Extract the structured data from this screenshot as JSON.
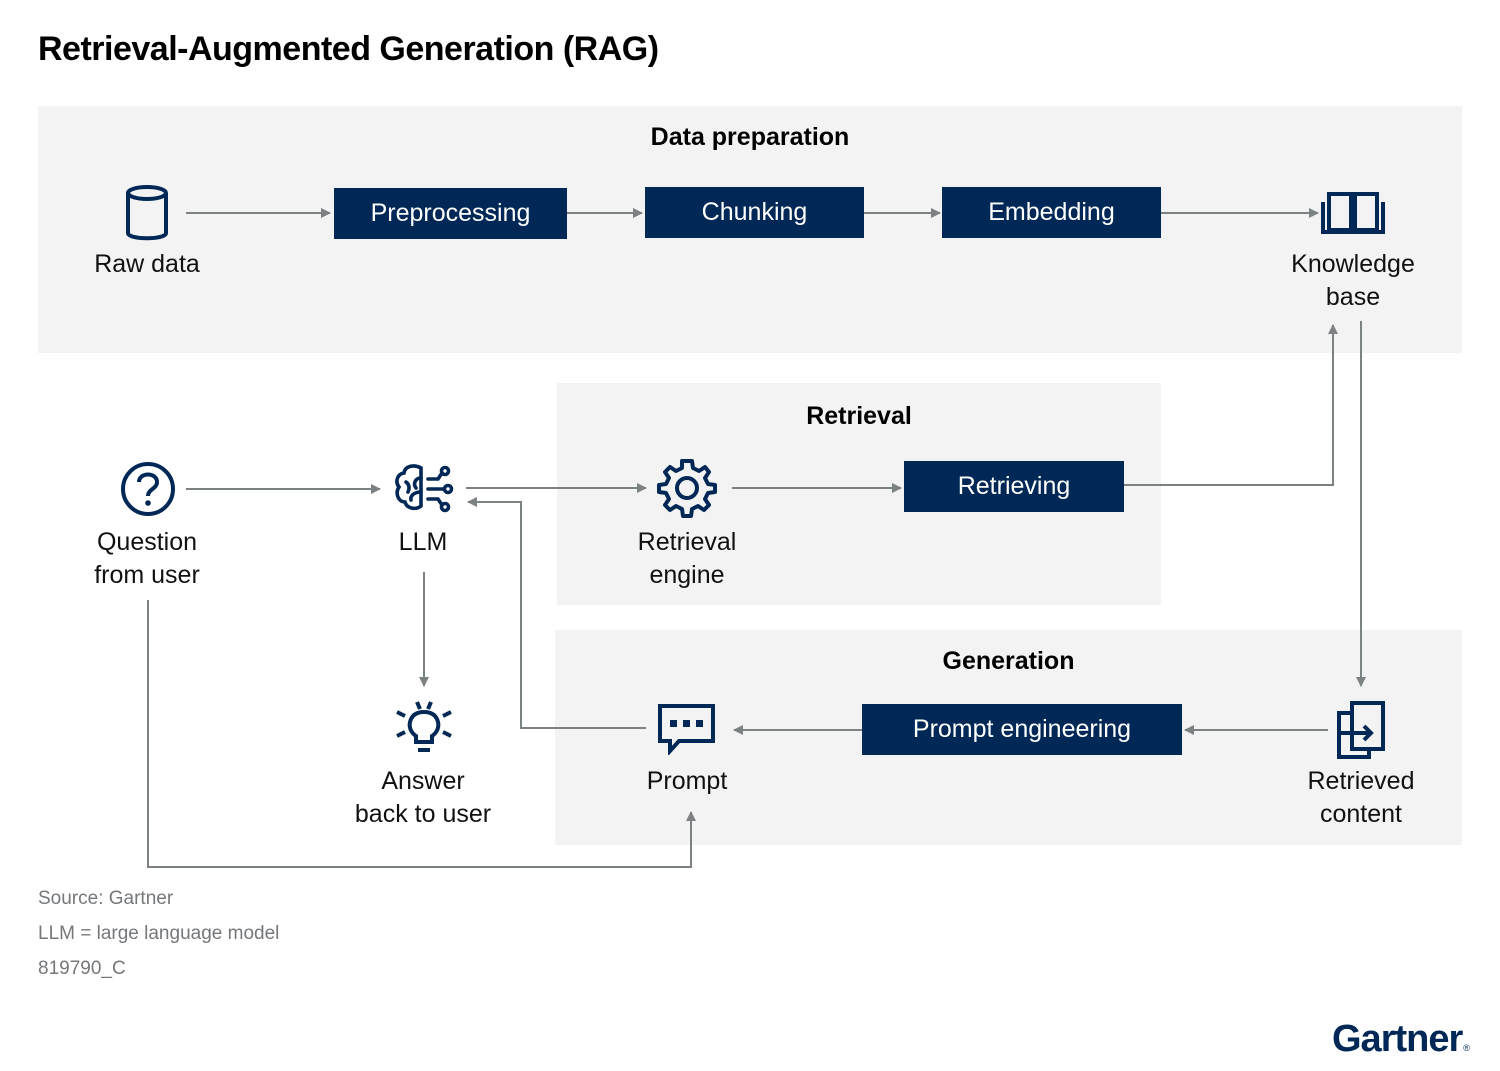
{
  "title": "Retrieval-Augmented Generation (RAG)",
  "colors": {
    "navy": "#002856",
    "panel": "#f3f3f3",
    "arrow": "#7c8283",
    "footnote": "#75787b"
  },
  "sections": {
    "data_preparation": "Data preparation",
    "retrieval": "Retrieval",
    "generation": "Generation"
  },
  "steps": {
    "preprocessing": "Preprocessing",
    "chunking": "Chunking",
    "embedding": "Embedding",
    "retrieving": "Retrieving",
    "prompt_engineering": "Prompt engineering"
  },
  "nodes": {
    "raw_data": {
      "icon": "database-icon",
      "label": "Raw data"
    },
    "knowledge_base": {
      "icon": "book-icon",
      "line1": "Knowledge",
      "line2": "base"
    },
    "question": {
      "icon": "question-icon",
      "line1": "Question",
      "line2": "from user"
    },
    "llm": {
      "icon": "brain-circuit-icon",
      "label": "LLM"
    },
    "retrieval_engine": {
      "icon": "gear-icon",
      "line1": "Retrieval",
      "line2": "engine"
    },
    "answer": {
      "icon": "lightbulb-icon",
      "line1": "Answer",
      "line2": "back to user"
    },
    "prompt": {
      "icon": "chat-bubble-icon",
      "label": "Prompt"
    },
    "retrieved_content": {
      "icon": "document-transfer-icon",
      "line1": "Retrieved",
      "line2": "content"
    }
  },
  "footnotes": {
    "source": "Source: Gartner",
    "abbr": "LLM = large language model",
    "id": "819790_C"
  },
  "logo": "Gartner"
}
